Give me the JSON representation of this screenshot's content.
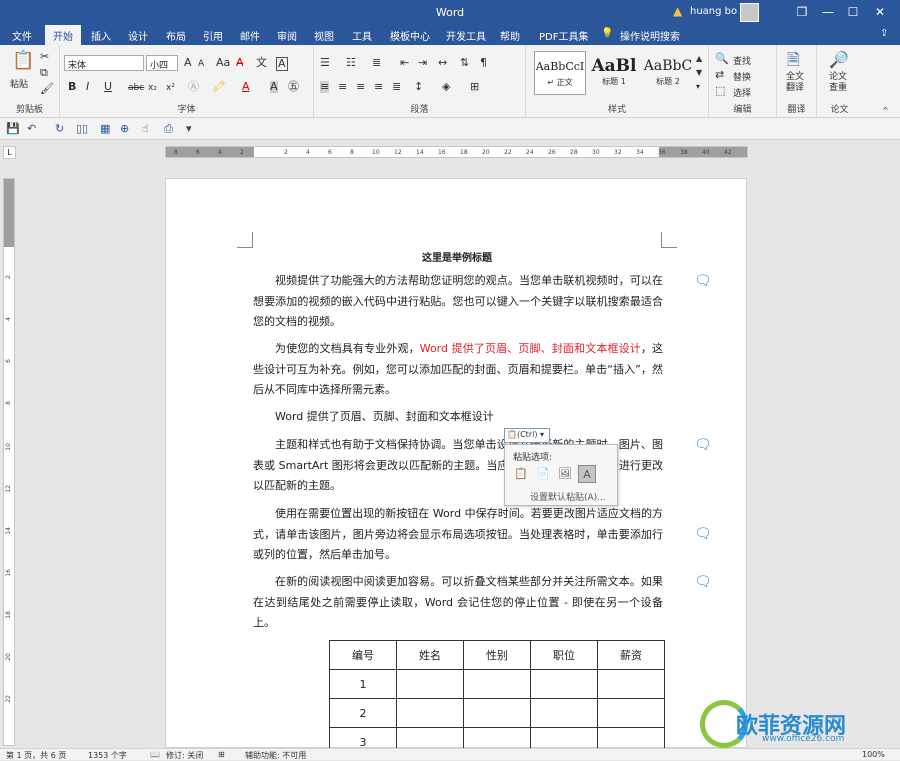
{
  "titlebar": {
    "title": "Word",
    "user": "huang bo",
    "restore_icon": "restore-icon",
    "minimize_icon": "minimize-icon",
    "maximize_icon": "maximize-icon",
    "close_icon": "close-icon"
  },
  "menu": [
    "文件",
    "开始",
    "插入",
    "设计",
    "布局",
    "引用",
    "邮件",
    "审阅",
    "视图",
    "工具",
    "模板中心",
    "开发工具",
    "帮助",
    "PDF工具集",
    "操作说明搜索"
  ],
  "menu_active": "开始",
  "ribbon": {
    "clipboard": {
      "label": "剪贴板",
      "paste": "粘贴"
    },
    "font": {
      "label": "字体",
      "font_name": "宋体",
      "font_size": "小四",
      "bold": "B",
      "italic": "I",
      "underline": "U",
      "strike": "abc",
      "sub": "x₂",
      "sup": "x²",
      "color_A": "A",
      "grow": "A",
      "shrink": "A",
      "aa": "Aa",
      "wen": "文",
      "A_box": "A"
    },
    "paragraph": {
      "label": "段落"
    },
    "styles": {
      "label": "样式",
      "items": [
        {
          "preview": "AaBbCcI",
          "name": "↵ 正文"
        },
        {
          "preview": "AaBl",
          "name": "标题 1"
        },
        {
          "preview": "AaBbC",
          "name": "标题 2"
        }
      ]
    },
    "editing": {
      "label": "编辑",
      "find": "查找",
      "replace": "替换",
      "select": "选择"
    },
    "translate": {
      "label": "翻译",
      "btn": "全文\n翻译"
    },
    "paper": {
      "label": "论文",
      "btn": "论文\n查重"
    }
  },
  "ruler_ticks": [
    "8",
    "6",
    "4",
    "2",
    "",
    "2",
    "4",
    "6",
    "8",
    "10",
    "12",
    "14",
    "16",
    "18",
    "20",
    "22",
    "24",
    "26",
    "28",
    "30",
    "32",
    "34",
    "36",
    "38",
    "40",
    "42"
  ],
  "vruler_ticks": [
    "2",
    "4",
    "6",
    "8",
    "10",
    "12",
    "14",
    "16",
    "18",
    "20",
    "22"
  ],
  "document": {
    "title": "这里是举例标题",
    "p1": "视频提供了功能强大的方法帮助您证明您的观点。当您单击联机视频时，可以在想要添加的视频的嵌入代码中进行粘贴。您也可以键入一个关键字以联机搜索最适合您的文档的视频。",
    "p2_a": "为使您的文档具有专业外观，",
    "p2_red": "Word 提供了页眉、页脚、封面和文本框设计",
    "p2_b": "，这些设计可互为补充。例如，您可以添加匹配的封面、页眉和提要栏。单击“插入”，然后从不同库中选择所需元素。",
    "p3": "Word 提供了页眉、页脚、封面和文本框设计",
    "p4": "主题和样式也有助于文档保持协调。当您单击设计并选择新的主题时，图片、图表或 SmartArt 图形将会更改以匹配新的主题。当应用样式时，您的标题会进行更改以匹配新的主题。",
    "p5": "使用在需要位置出现的新按钮在 Word 中保存时间。若要更改图片适应文档的方式，请单击该图片，图片旁边将会显示布局选项按钮。当处理表格时，单击要添加行或列的位置，然后单击加号。",
    "p6": "在新的阅读视图中阅读更加容易。可以折叠文档某些部分并关注所需文本。如果在达到结尾处之前需要停止读取，Word 会记住您的停止位置 - 即使在另一个设备上。",
    "table_headers": [
      "编号",
      "姓名",
      "性别",
      "职位",
      "薪资"
    ],
    "table_rows": [
      [
        "1",
        "",
        "",
        "",
        ""
      ],
      [
        "2",
        "",
        "",
        "",
        ""
      ],
      [
        "3",
        "",
        "",
        "",
        ""
      ]
    ]
  },
  "paste_popup": {
    "button": "(Ctrl)",
    "title": "粘贴选项:",
    "default": "设置默认粘贴(A)..."
  },
  "status": {
    "page": "第 1 页，共 6 页",
    "words": "1353 个字",
    "track": "修订: 关闭",
    "access": "辅助功能: 不可用",
    "zoom": "100%"
  },
  "watermark": {
    "name": "欧菲资源网",
    "url": "www.office26.com"
  }
}
